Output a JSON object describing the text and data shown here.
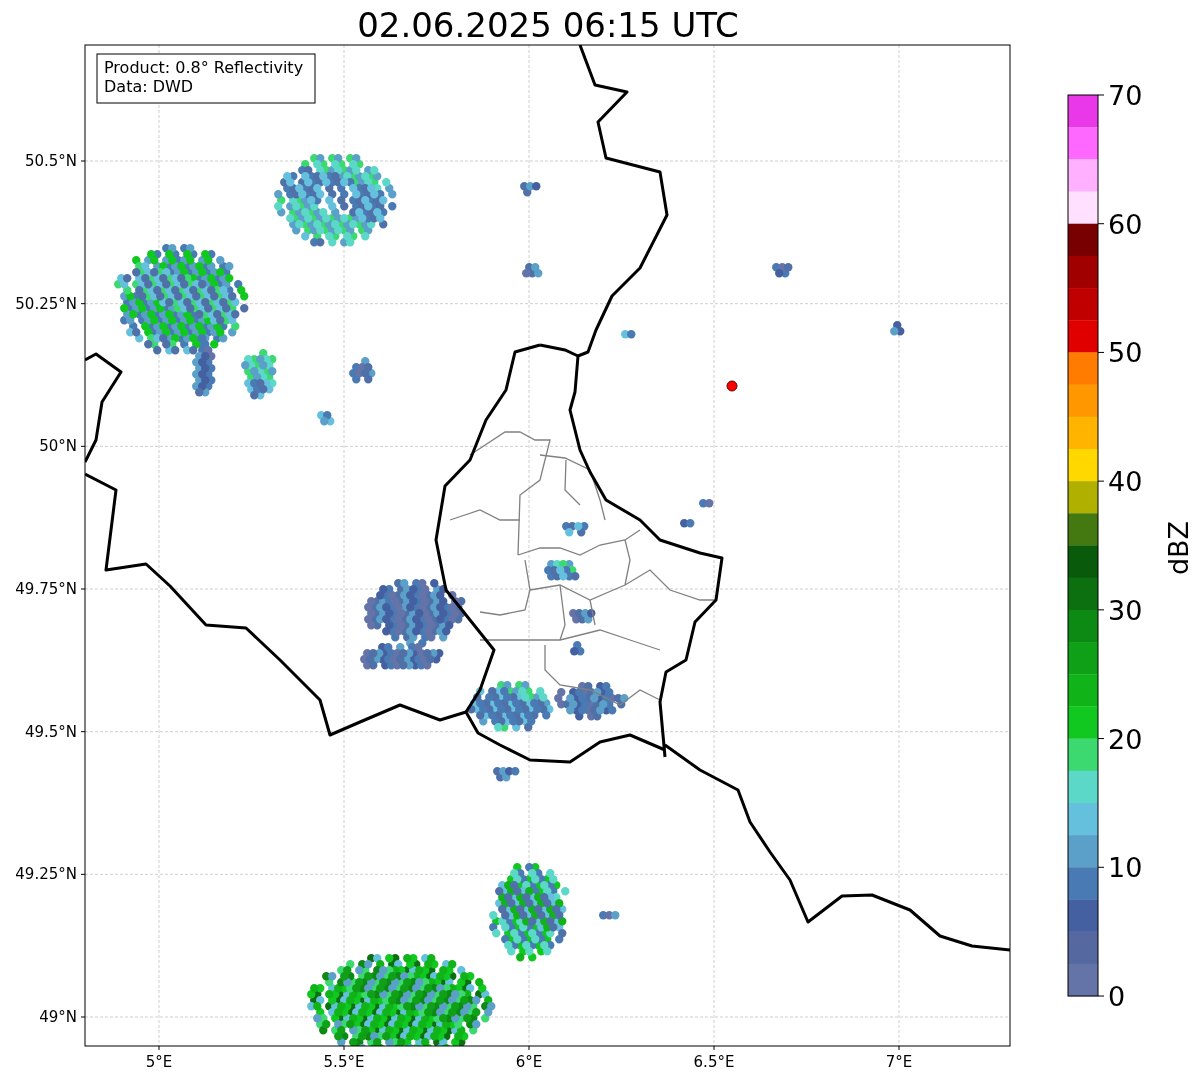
{
  "title": "02.06.2025 06:15 UTC",
  "legend": {
    "lines": [
      "Product: 0.8° Reflectivity",
      "Data: DWD"
    ]
  },
  "map": {
    "xticks": [
      "5°E",
      "5.5°E",
      "6°E",
      "6.5°E",
      "7°E"
    ],
    "yticks": [
      "50.5°N",
      "50.25°N",
      "50°N",
      "49.75°N",
      "49.5°N",
      "49.25°N",
      "49°N"
    ]
  },
  "colorbar": {
    "label": "dBZ",
    "ticks": [
      "70",
      "60",
      "50",
      "40",
      "30",
      "20",
      "10",
      "0"
    ],
    "segments": [
      {
        "color": "#e838e8"
      },
      {
        "color": "#ff68ff"
      },
      {
        "color": "#ffb0ff"
      },
      {
        "color": "#ffe0ff"
      },
      {
        "color": "#780000"
      },
      {
        "color": "#a00000"
      },
      {
        "color": "#c00000"
      },
      {
        "color": "#e00000"
      },
      {
        "color": "#ff7c00"
      },
      {
        "color": "#ff9800"
      },
      {
        "color": "#ffb400"
      },
      {
        "color": "#ffd800"
      },
      {
        "color": "#b0b000"
      },
      {
        "color": "#447810"
      },
      {
        "color": "#0a5a0c"
      },
      {
        "color": "#0c7010"
      },
      {
        "color": "#0c8a14"
      },
      {
        "color": "#10a018"
      },
      {
        "color": "#10b418"
      },
      {
        "color": "#10c820"
      },
      {
        "color": "#3cd870"
      },
      {
        "color": "#5cd8c8"
      },
      {
        "color": "#64c0dc"
      },
      {
        "color": "#5aa0c8"
      },
      {
        "color": "#4a7ab4"
      },
      {
        "color": "#4460a0"
      },
      {
        "color": "#5568a0"
      },
      {
        "color": "#6474a8"
      }
    ]
  }
}
